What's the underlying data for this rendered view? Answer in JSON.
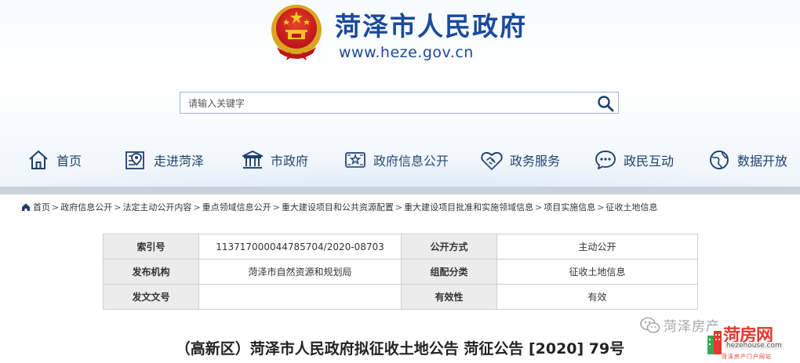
{
  "header": {
    "site_title": "菏泽市人民政府",
    "site_url": "www.heze.gov.cn",
    "emblem_icon": "national-emblem-icon"
  },
  "search": {
    "placeholder": "请输入关键字",
    "button_icon": "search-icon"
  },
  "nav": {
    "items": [
      {
        "label": "首页",
        "icon": "home-icon"
      },
      {
        "label": "走进菏泽",
        "icon": "map-pin-icon"
      },
      {
        "label": "市政府",
        "icon": "government-building-icon"
      },
      {
        "label": "政府信息公开",
        "icon": "info-document-icon"
      },
      {
        "label": "政务服务",
        "icon": "handshake-icon"
      },
      {
        "label": "政民互动",
        "icon": "chat-bubble-icon"
      },
      {
        "label": "数据开放",
        "icon": "data-globe-icon"
      }
    ]
  },
  "breadcrumb": {
    "items": [
      "首页",
      "政府信息公开",
      "法定主动公开内容",
      "重点领域信息公开",
      "重大建设项目和公共资源配置",
      "重大建设项目批准和实施领域信息",
      "项目实施信息",
      "征收土地信息"
    ],
    "separator": ">"
  },
  "meta_table": {
    "rows": [
      {
        "k1": "索引号",
        "v1": "113717000044785704/2020-08703",
        "k2": "公开方式",
        "v2": "主动公开"
      },
      {
        "k1": "发布机构",
        "v1": "菏泽市自然资源和规划局",
        "k2": "组配分类",
        "v2": "征收土地信息"
      },
      {
        "k1": "发文文号",
        "v1": "",
        "k2": "有效性",
        "v2": "有效"
      }
    ]
  },
  "document": {
    "title": "（高新区）菏泽市人民政府拟征收土地公告 菏征公告 [2020] 79号"
  },
  "watermark": {
    "wechat_text": "菏泽房产",
    "brand": "菏房网",
    "domain": "hezehouse.com",
    "slogan": "菏泽房产门户网站"
  },
  "colors": {
    "brand_blue": "#1a4a9c",
    "nav_text": "#1d3f6e",
    "nav_bar": "#c8d3dc",
    "table_header_bg": "#ececec",
    "watermark_red": "#e13b2f"
  }
}
